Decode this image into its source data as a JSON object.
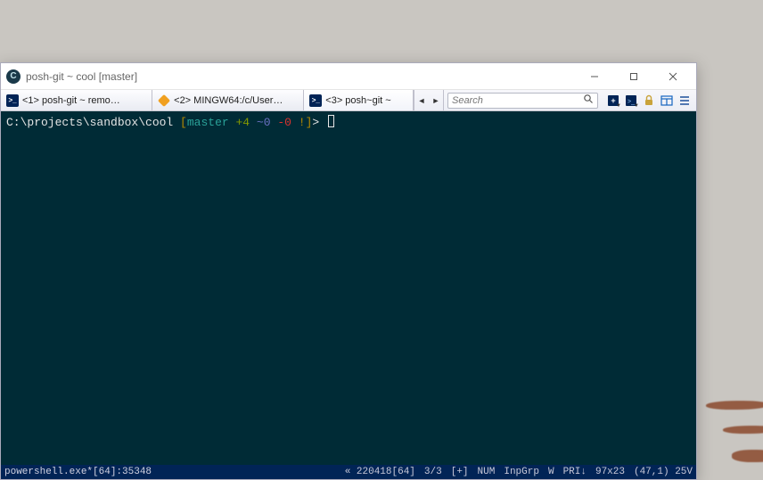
{
  "window": {
    "title": "posh-git ~ cool [master]"
  },
  "tabs": [
    {
      "label": "<1>  posh-git ~ remo…",
      "icon": "ps"
    },
    {
      "label": "<2>  MINGW64:/c/User…",
      "icon": "git"
    },
    {
      "label": "<3>  posh~git ~ ",
      "icon": "ps"
    }
  ],
  "search": {
    "placeholder": "Search"
  },
  "prompt": {
    "path": "C:\\projects\\sandbox\\cool ",
    "branch": "master",
    "added": "+4",
    "modified": "~0",
    "deleted": "-0",
    "bang": "!",
    "gt": ">"
  },
  "status": {
    "left": "powershell.exe*[64]:35348",
    "mem": "« 220418[64]",
    "proc": "3/3",
    "plus": "[+]",
    "num": "NUM",
    "inp": "InpGrp",
    "w": "W",
    "pri": "PRI↓",
    "size": "97x23",
    "pos": "(47,1) 25V"
  }
}
